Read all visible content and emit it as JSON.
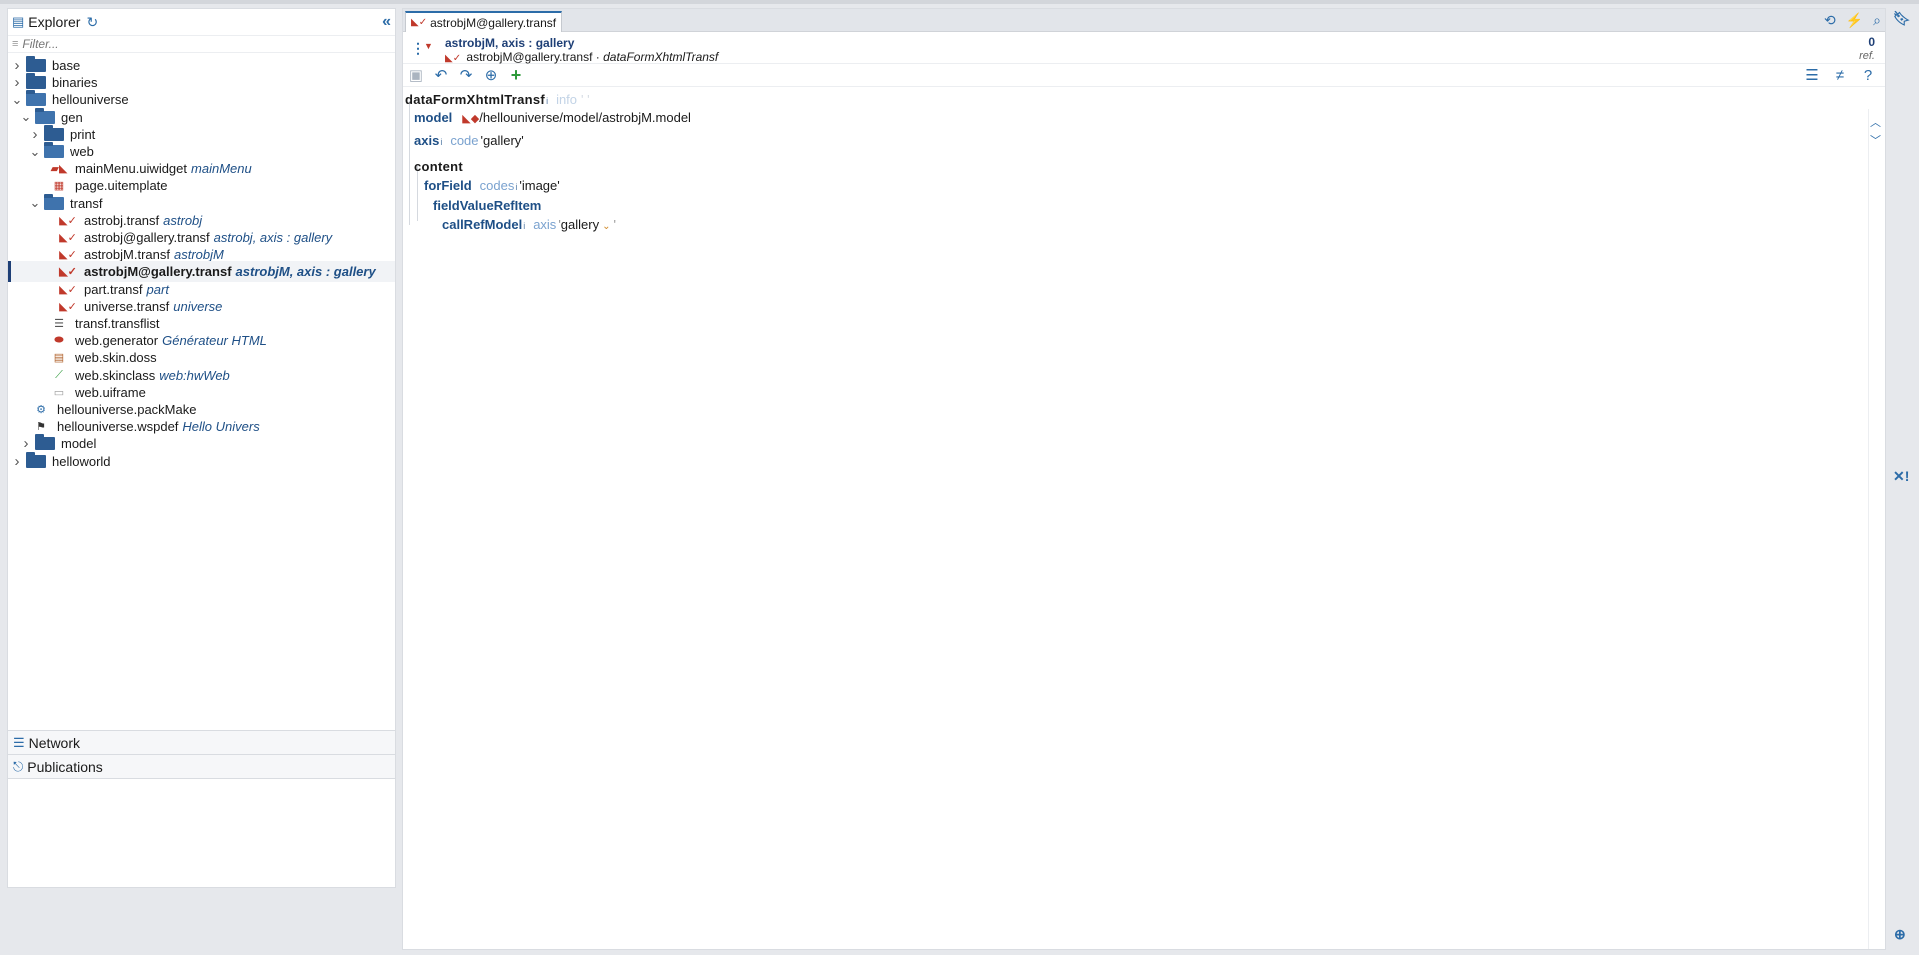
{
  "explorer": {
    "title": "Explorer",
    "filter_placeholder": "Filter...",
    "tree": [
      {
        "label": "base",
        "type": "folder"
      },
      {
        "label": "binaries",
        "type": "folder"
      },
      {
        "label": "hellouniverse",
        "type": "folder"
      },
      {
        "label": "gen",
        "type": "folder"
      },
      {
        "label": "print",
        "type": "folder"
      },
      {
        "label": "web",
        "type": "folder"
      },
      {
        "label": "mainMenu.uiwidget",
        "desc": "mainMenu",
        "type": "uiwidget"
      },
      {
        "label": "page.uitemplate",
        "type": "uitemplate"
      },
      {
        "label": "transf",
        "type": "folder"
      },
      {
        "label": "astrobj.transf",
        "desc": "astrobj",
        "type": "transf"
      },
      {
        "label": "astrobj@gallery.transf",
        "desc": "astrobj, axis : gallery",
        "type": "transf"
      },
      {
        "label": "astrobjM.transf",
        "desc": "astrobjM",
        "type": "transf"
      },
      {
        "label": "astrobjM@gallery.transf",
        "desc": "astrobjM, axis : gallery",
        "type": "transf",
        "selected": true
      },
      {
        "label": "part.transf",
        "desc": "part",
        "type": "transf"
      },
      {
        "label": "universe.transf",
        "desc": "universe",
        "type": "transf"
      },
      {
        "label": "transf.transflist",
        "type": "transflist"
      },
      {
        "label": "web.generator",
        "desc": "Générateur HTML",
        "type": "generator"
      },
      {
        "label": "web.skin.doss",
        "type": "skin"
      },
      {
        "label": "web.skinclass",
        "desc": "web:hwWeb",
        "type": "skinclass"
      },
      {
        "label": "web.uiframe",
        "type": "uiframe"
      },
      {
        "label": "hellouniverse.packMake",
        "type": "packmake"
      },
      {
        "label": "hellouniverse.wspdef",
        "desc": "Hello Univers",
        "type": "wspdef"
      },
      {
        "label": "model",
        "type": "folder"
      },
      {
        "label": "helloworld",
        "type": "folder"
      }
    ]
  },
  "panels": {
    "network": "Network",
    "publications": "Publications"
  },
  "editor": {
    "tab_label": "astrobjM@gallery.transf",
    "header_title": "astrobjM, axis : gallery",
    "header_file": "astrobjM@gallery.transf",
    "header_sep": "·",
    "header_type": "dataFormXhtmlTransf",
    "ref_count": "0",
    "ref_label": "ref.",
    "content": {
      "root": "dataFormXhtmlTransf",
      "info_sup": "i",
      "info_attr": "info",
      "info_quote": "' '",
      "model_kw": "model",
      "model_path": "/hellouniverse/model/astrobjM.model",
      "axis_kw": "axis",
      "code_attr": "code",
      "axis_value": "'gallery'",
      "content_kw": "content",
      "forfield_kw": "forField",
      "codes_attr": "codes",
      "codes_value": "'image'",
      "fieldvalue_kw": "fieldValueRefItem",
      "callref_kw": "callRefModel",
      "callref_attr": "axis",
      "callref_open": "'",
      "callref_value": "gallery",
      "callref_close": "'"
    }
  },
  "colors": {
    "accent": "#2c6ca8",
    "keyword": "#1e4f86",
    "attribute": "#7aa2cf",
    "transf_icon": "#c0392b",
    "add_green": "#2e9a3a"
  }
}
